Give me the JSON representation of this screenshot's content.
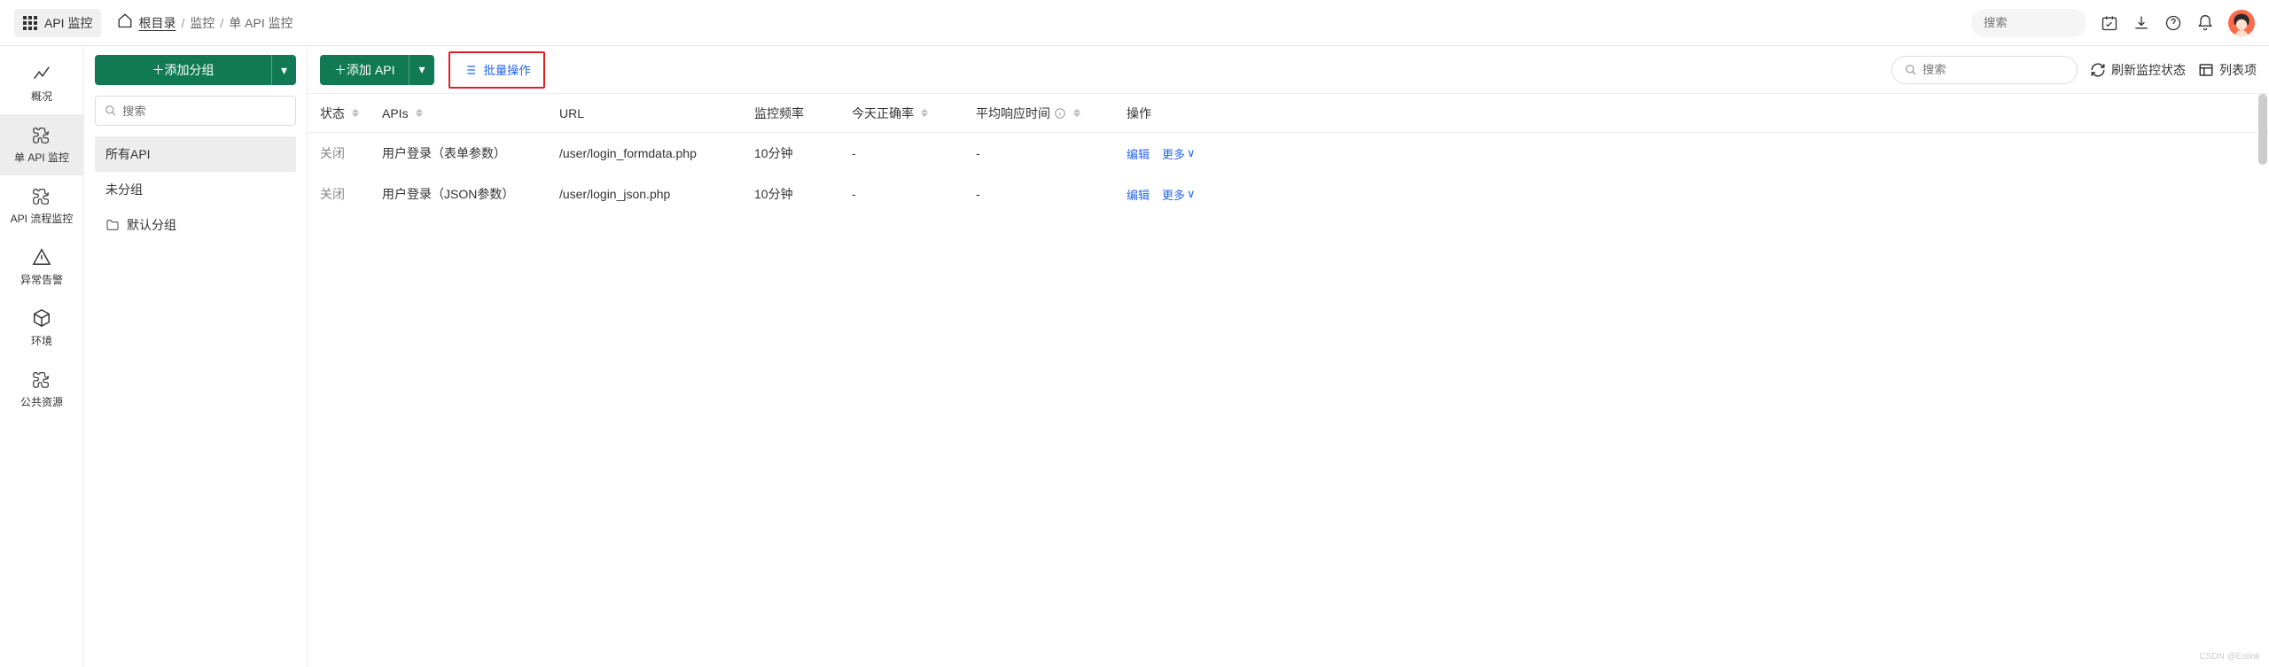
{
  "header": {
    "app_name": "API 监控",
    "breadcrumb": {
      "root": "根目录",
      "mid": "监控",
      "current": "单 API 监控"
    },
    "search_placeholder": "搜索"
  },
  "sidebar": {
    "items": [
      {
        "label": "概况"
      },
      {
        "label": "单 API 监控"
      },
      {
        "label": "API 流程监控"
      },
      {
        "label": "异常告警"
      },
      {
        "label": "环境"
      },
      {
        "label": "公共资源"
      }
    ]
  },
  "group_panel": {
    "add_group": "添加分组",
    "search_placeholder": "搜索",
    "items": [
      {
        "label": "所有API"
      },
      {
        "label": "未分组"
      },
      {
        "label": "默认分组"
      }
    ]
  },
  "main": {
    "add_api": "添加 API",
    "batch_ops": "批量操作",
    "search_placeholder": "搜索",
    "refresh_status": "刷新监控状态",
    "columns_btn": "列表项",
    "columns": {
      "status": "状态",
      "apis": "APIs",
      "url": "URL",
      "freq": "监控频率",
      "rate": "今天正确率",
      "resp": "平均响应时间",
      "ops": "操作"
    },
    "rows": [
      {
        "status": "关闭",
        "api": "用户登录（表单参数）",
        "url": "/user/login_formdata.php",
        "freq": "10分钟",
        "rate": "-",
        "resp": "-",
        "edit": "编辑",
        "more": "更多"
      },
      {
        "status": "关闭",
        "api": "用户登录（JSON参数）",
        "url": "/user/login_json.php",
        "freq": "10分钟",
        "rate": "-",
        "resp": "-",
        "edit": "编辑",
        "more": "更多"
      }
    ],
    "watermark": "CSDN @Eolink"
  }
}
